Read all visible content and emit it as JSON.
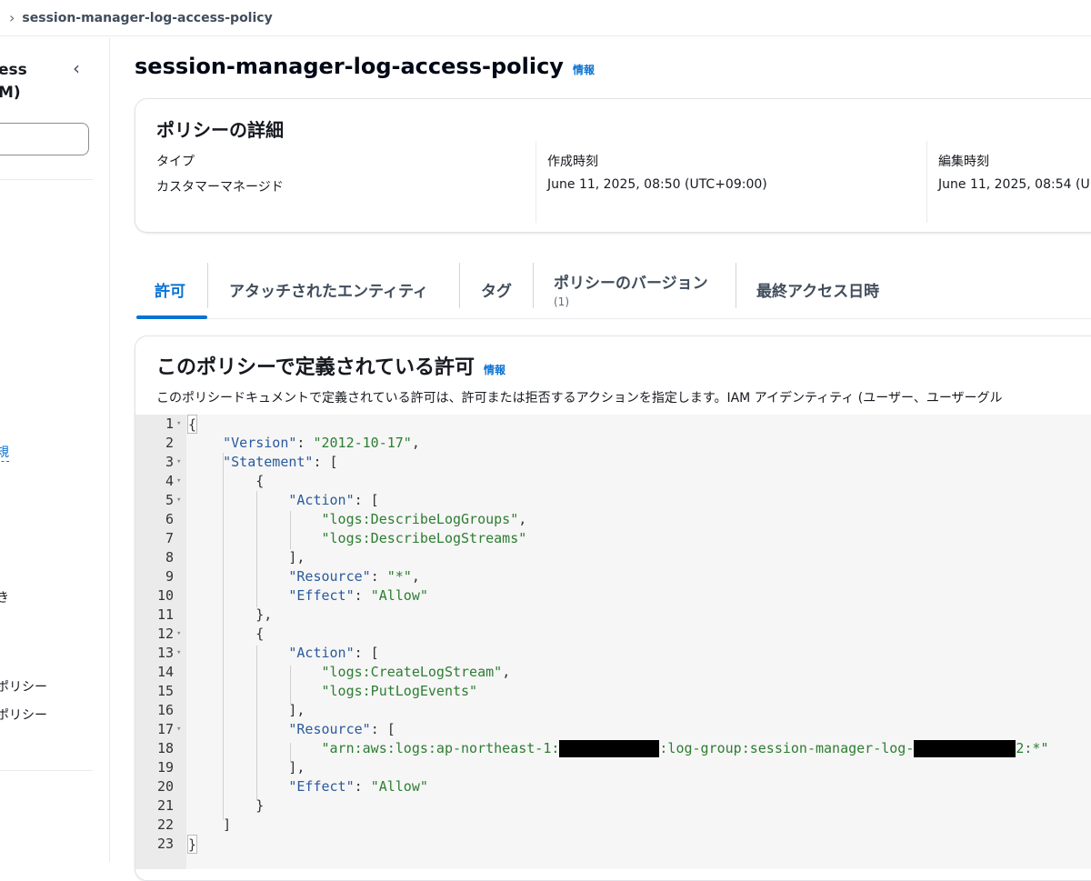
{
  "breadcrumb": {
    "current": "session-manager-log-access-policy"
  },
  "sidebar": {
    "service_title_line1": "ess",
    "service_title_line2": "M)",
    "nav_new": "規",
    "nav_item_a": "ポリシー",
    "nav_item_b": "ポリシー",
    "nav_item_c": "き"
  },
  "page": {
    "title": "session-manager-log-access-policy",
    "info": "情報"
  },
  "details": {
    "heading": "ポリシーの詳細",
    "type_label": "タイプ",
    "type_value": "カスタマーマネージド",
    "created_label": "作成時刻",
    "created_value": "June 11, 2025, 08:50 (UTC+09:00)",
    "edited_label": "編集時刻",
    "edited_value": "June 11, 2025, 08:54 (U"
  },
  "tabs": [
    {
      "label": "許可",
      "active": true
    },
    {
      "label": "アタッチされたエンティティ"
    },
    {
      "label": "タグ"
    },
    {
      "label": "ポリシーのバージョン",
      "sub": "(1)"
    },
    {
      "label": "最終アクセス日時"
    }
  ],
  "permissions": {
    "heading": "このポリシーで定義されている許可",
    "info": "情報",
    "description": "このポリシードキュメントで定義されている許可は、許可または拒否するアクションを指定します。IAM アイデンティティ (ユーザー、ユーザーグル"
  },
  "policy_json": {
    "version_key": "\"Version\"",
    "version_val": "\"2012-10-17\"",
    "statement_key": "\"Statement\"",
    "action_key": "\"Action\"",
    "resource_key": "\"Resource\"",
    "effect_key": "\"Effect\"",
    "s1_action_1": "\"logs:DescribeLogGroups\"",
    "s1_action_2": "\"logs:DescribeLogStreams\"",
    "s1_resource": "\"*\"",
    "allow": "\"Allow\"",
    "s2_action_1": "\"logs:CreateLogStream\"",
    "s2_action_2": "\"logs:PutLogEvents\"",
    "s2_resource_a": "\"arn:aws:logs:ap-northeast-1:",
    "s2_resource_b": ":log-group:session-manager-log-",
    "s2_resource_c": "2:*\""
  },
  "line_numbers": [
    "1",
    "2",
    "3",
    "4",
    "5",
    "6",
    "7",
    "8",
    "9",
    "10",
    "11",
    "12",
    "13",
    "14",
    "15",
    "16",
    "17",
    "18",
    "19",
    "20",
    "21",
    "22",
    "23"
  ]
}
